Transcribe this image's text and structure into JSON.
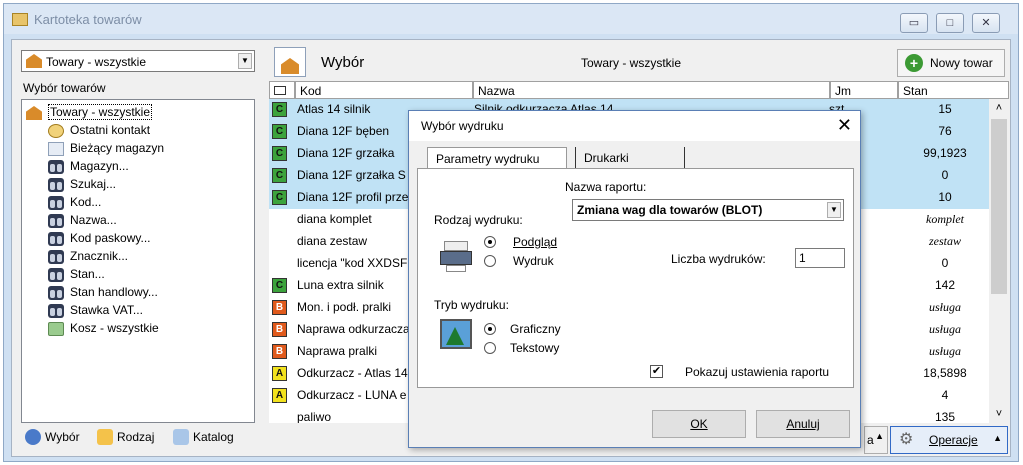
{
  "window": {
    "title": "Kartoteka towarów",
    "min_btn": "▭",
    "max_btn": "□",
    "close_btn": "✕"
  },
  "left": {
    "combo_value": "Towary - wszystkie",
    "section_label": "Wybór towarów",
    "tree": [
      {
        "label": "Towary - wszystkie",
        "icon": "house-icon"
      },
      {
        "label": "Ostatni kontakt",
        "icon": "clock-icon"
      },
      {
        "label": "Bieżący magazyn",
        "icon": "grid-icon"
      },
      {
        "label": "Magazyn...",
        "icon": "binoculars-icon"
      },
      {
        "label": "Szukaj...",
        "icon": "binoculars-icon"
      },
      {
        "label": "Kod...",
        "icon": "binoculars-icon"
      },
      {
        "label": "Nazwa...",
        "icon": "binoculars-icon"
      },
      {
        "label": "Kod paskowy...",
        "icon": "binoculars-icon"
      },
      {
        "label": "Znacznik...",
        "icon": "binoculars-icon"
      },
      {
        "label": "Stan...",
        "icon": "binoculars-icon"
      },
      {
        "label": "Stan handlowy...",
        "icon": "binoculars-icon"
      },
      {
        "label": "Stawka VAT...",
        "icon": "binoculars-icon"
      },
      {
        "label": "Kosz - wszystkie",
        "icon": "trash-icon"
      }
    ],
    "tabs": [
      "Wybór",
      "Rodzaj",
      "Katalog"
    ]
  },
  "right": {
    "header_label": "Wybór",
    "header_center": "Towary - wszystkie",
    "new_button": "Nowy towar",
    "columns": [
      "Kod",
      "Nazwa",
      "Jm",
      "Stan"
    ],
    "rows": [
      {
        "badge": "C",
        "kod": "Atlas 14 silnik",
        "nazwa": "Silnik odkurzacza Atlas 14",
        "jm": "szt",
        "stan": "15",
        "sel": true
      },
      {
        "badge": "C",
        "kod": "Diana 12F bęben",
        "nazwa": "",
        "jm": "",
        "stan": "76",
        "sel": true
      },
      {
        "badge": "C",
        "kod": "Diana 12F grzałka",
        "nazwa": "",
        "jm": "",
        "stan": "99,1923",
        "sel": true
      },
      {
        "badge": "C",
        "kod": "Diana 12F grzałka S",
        "nazwa": "",
        "jm": "",
        "stan": "0",
        "sel": true
      },
      {
        "badge": "C",
        "kod": "Diana 12F profil prze",
        "nazwa": "",
        "jm": "",
        "stan": "10",
        "sel": true
      },
      {
        "badge": "",
        "kod": "diana komplet",
        "nazwa": "",
        "jm": "",
        "stan": "komplet",
        "italic": true
      },
      {
        "badge": "",
        "kod": "diana zestaw",
        "nazwa": "",
        "jm": "",
        "stan": "zestaw",
        "italic": true
      },
      {
        "badge": "",
        "kod": "licencja \"kod XXDSF",
        "nazwa": "",
        "jm": "",
        "stan": "0"
      },
      {
        "badge": "C",
        "kod": "Luna extra silnik",
        "nazwa": "",
        "jm": "",
        "stan": "142"
      },
      {
        "badge": "B",
        "kod": "Mon. i podł. pralki",
        "nazwa": "",
        "jm": "",
        "stan": "usługa",
        "italic": true
      },
      {
        "badge": "B",
        "kod": "Naprawa odkurzacza",
        "nazwa": "",
        "jm": "",
        "stan": "usługa",
        "italic": true
      },
      {
        "badge": "B",
        "kod": "Naprawa pralki",
        "nazwa": "",
        "jm": "",
        "stan": "usługa",
        "italic": true
      },
      {
        "badge": "A",
        "kod": "Odkurzacz - Atlas 14",
        "nazwa": "",
        "jm": "",
        "stan": "18,5898"
      },
      {
        "badge": "A",
        "kod": "Odkurzacz - LUNA e",
        "nazwa": "",
        "jm": "",
        "stan": "4"
      },
      {
        "badge": "",
        "kod": "paliwo",
        "nazwa": "",
        "jm": "",
        "stan": "135"
      }
    ],
    "small_btn_label": "a",
    "operations_button": "Operacje"
  },
  "dialog": {
    "title": "Wybór wydruku",
    "tabs": [
      "Parametry wydruku",
      "Drukarki"
    ],
    "report_name_label": "Nazwa raportu:",
    "report_name_value": "Zmiana wag dla towarów (BLOT)",
    "print_type_label": "Rodzaj wydruku:",
    "print_options": [
      "Podgląd",
      "Wydruk"
    ],
    "print_count_label": "Liczba wydruków:",
    "print_count_value": "1",
    "print_mode_label": "Tryb wydruku:",
    "mode_options": [
      "Graficzny",
      "Tekstowy"
    ],
    "show_settings_label": "Pokazuj ustawienia raportu",
    "show_settings_checked": "✔",
    "ok_button": "OK",
    "cancel_button": "Anuluj"
  }
}
